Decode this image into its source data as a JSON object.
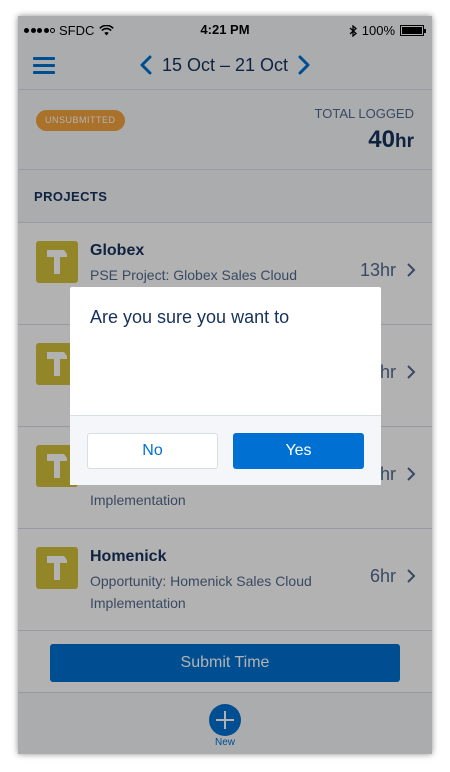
{
  "status_bar": {
    "carrier": "SFDC",
    "time": "4:21 PM",
    "battery": "100%",
    "signal_icon": "signal-dots-icon",
    "wifi_icon": "wifi-icon",
    "bluetooth_icon": "bluetooth-icon",
    "battery_icon": "battery-icon"
  },
  "nav": {
    "date_range": "15 Oct – 21 Oct",
    "menu_icon": "hamburger-menu-icon",
    "prev_icon": "chevron-left-icon",
    "next_icon": "chevron-right-icon"
  },
  "summary": {
    "status_badge": "UNSUBMITTED",
    "total_label": "TOTAL LOGGED",
    "total_value": "40",
    "total_unit": "hr"
  },
  "projects": {
    "header": "PROJECTS",
    "items": [
      {
        "title": "Globex",
        "subtitle": "PSE Project: Globex Sales Cloud",
        "hours": "13hr",
        "icon": "hammer-icon"
      },
      {
        "title": "",
        "subtitle": "",
        "hours": "hr",
        "icon": "hammer-icon"
      },
      {
        "title": "",
        "subtitle": "Implementation",
        "hours": "hr",
        "icon": "hammer-icon"
      },
      {
        "title": "Homenick",
        "subtitle": "Opportunity: Homenick Sales Cloud Implementation",
        "hours": "6hr",
        "icon": "hammer-icon"
      }
    ]
  },
  "actions": {
    "submit_label": "Submit Time",
    "new_label": "New",
    "new_icon": "plus-circle-icon"
  },
  "dialog": {
    "message": "Are you sure you want to",
    "no_label": "No",
    "yes_label": "Yes"
  },
  "colors": {
    "accent": "#0070d2",
    "badge": "#f2a33c",
    "project_icon": "#d1c13a",
    "text_primary": "#16325c",
    "text_secondary": "#54698d"
  }
}
